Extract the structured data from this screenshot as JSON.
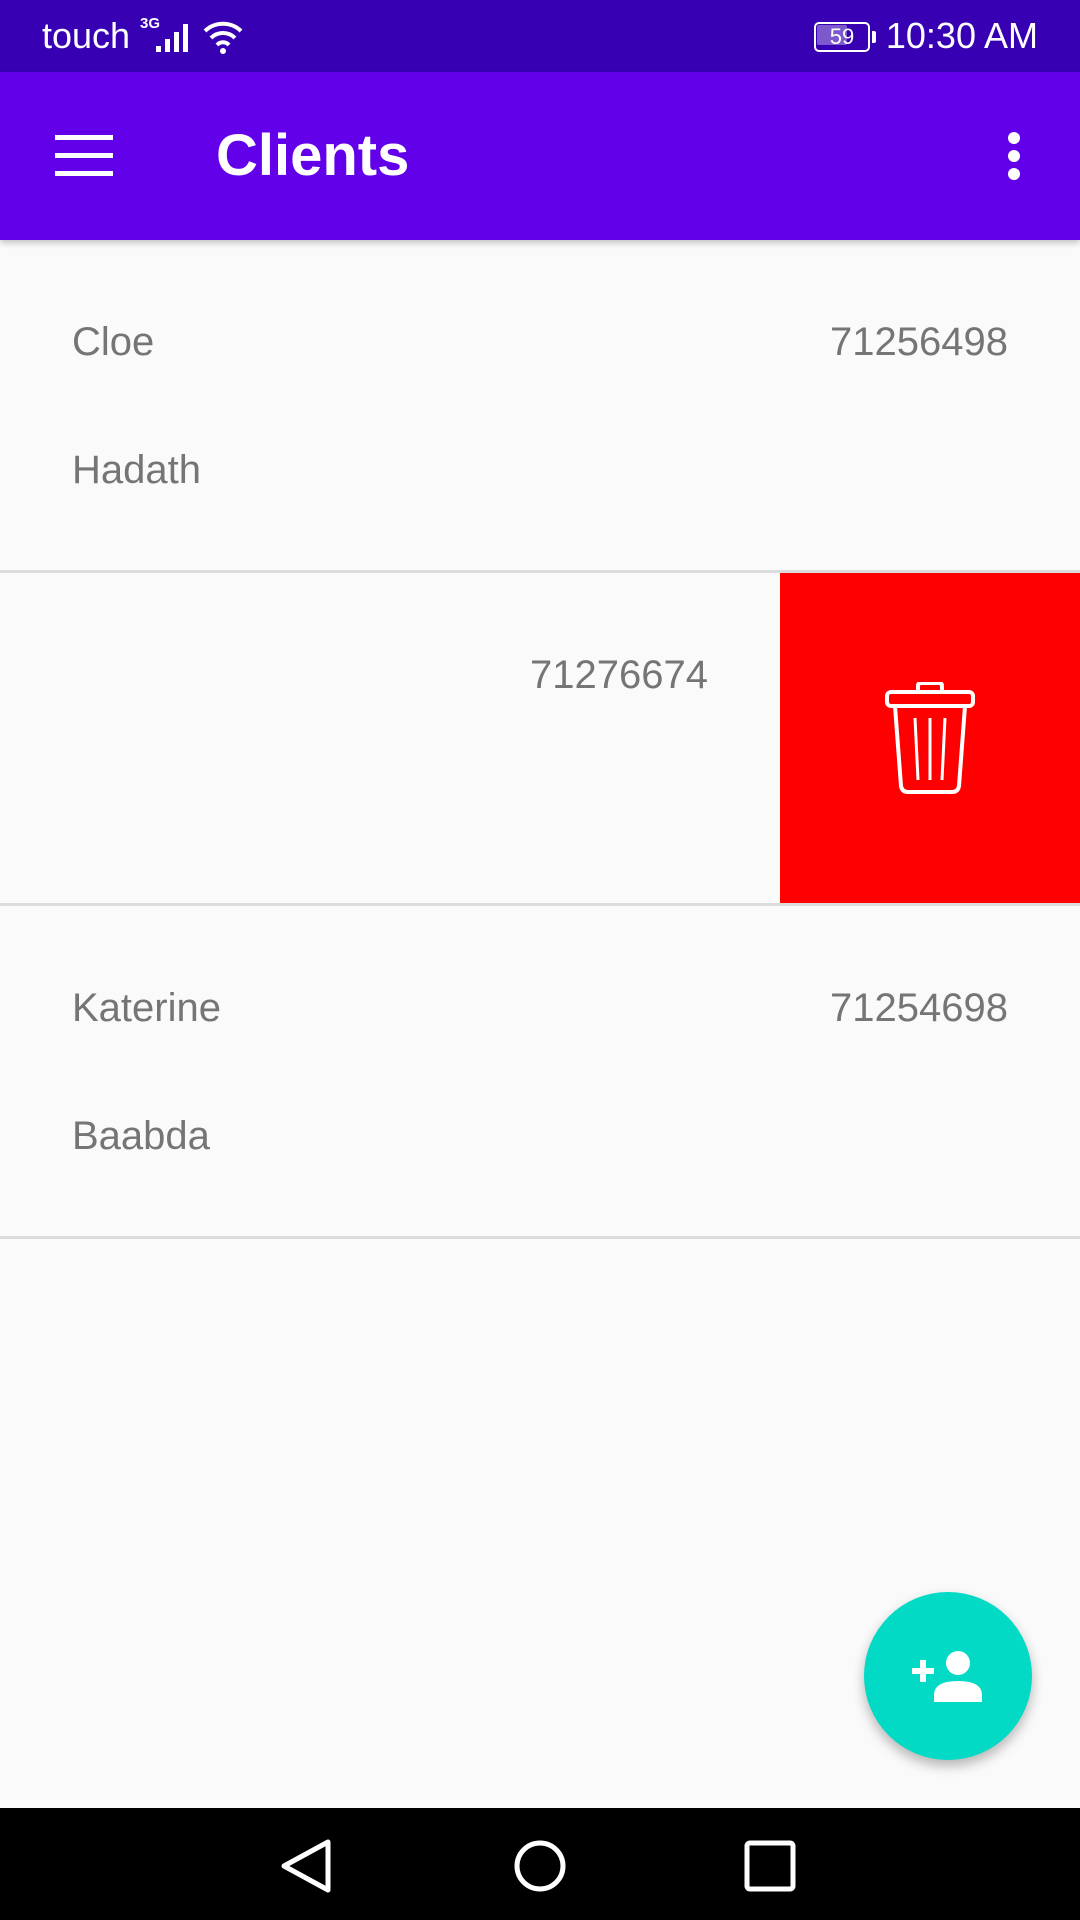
{
  "status_bar": {
    "carrier": "touch",
    "network_type": "3G",
    "battery_level": "59",
    "time": "10:30 AM"
  },
  "app_bar": {
    "title": "Clients",
    "menu_icon": "hamburger-menu-icon",
    "overflow_icon": "more-vertical-icon",
    "background": "#6200ea"
  },
  "clients": [
    {
      "name": "Cloe",
      "city": "Hadath",
      "phone": "71256498"
    },
    {
      "name": "",
      "city": "",
      "phone": "71276674",
      "swiped": true,
      "swipe_action_icon": "trash-icon"
    },
    {
      "name": "Katerine",
      "city": "Baabda",
      "phone": "71254698"
    }
  ],
  "fab": {
    "icon": "add-person-icon",
    "color": "#03dac5"
  },
  "swipe_action_color": "#ff0000",
  "nav_bar": {
    "icons": [
      "back-icon",
      "home-icon",
      "recents-icon"
    ]
  }
}
